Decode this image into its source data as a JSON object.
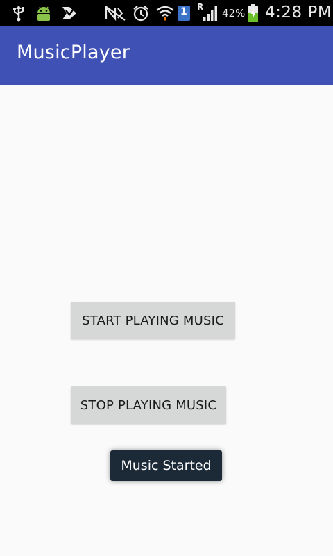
{
  "status_bar": {
    "icons": [
      "usb-icon",
      "android-icon",
      "download-icon",
      "nfc-icon",
      "alarm-icon",
      "wifi-icon",
      "sim-icon",
      "signal-icon",
      "battery-icon"
    ],
    "sim_number": "1",
    "roaming": "R",
    "battery_percent": "42%",
    "time": "4:28 PM"
  },
  "app_bar": {
    "title": "MusicPlayer",
    "color": "#3f51b5"
  },
  "buttons": {
    "start": "START PLAYING MUSIC",
    "stop": "STOP PLAYING MUSIC"
  },
  "toast": {
    "message": "Music Started"
  }
}
